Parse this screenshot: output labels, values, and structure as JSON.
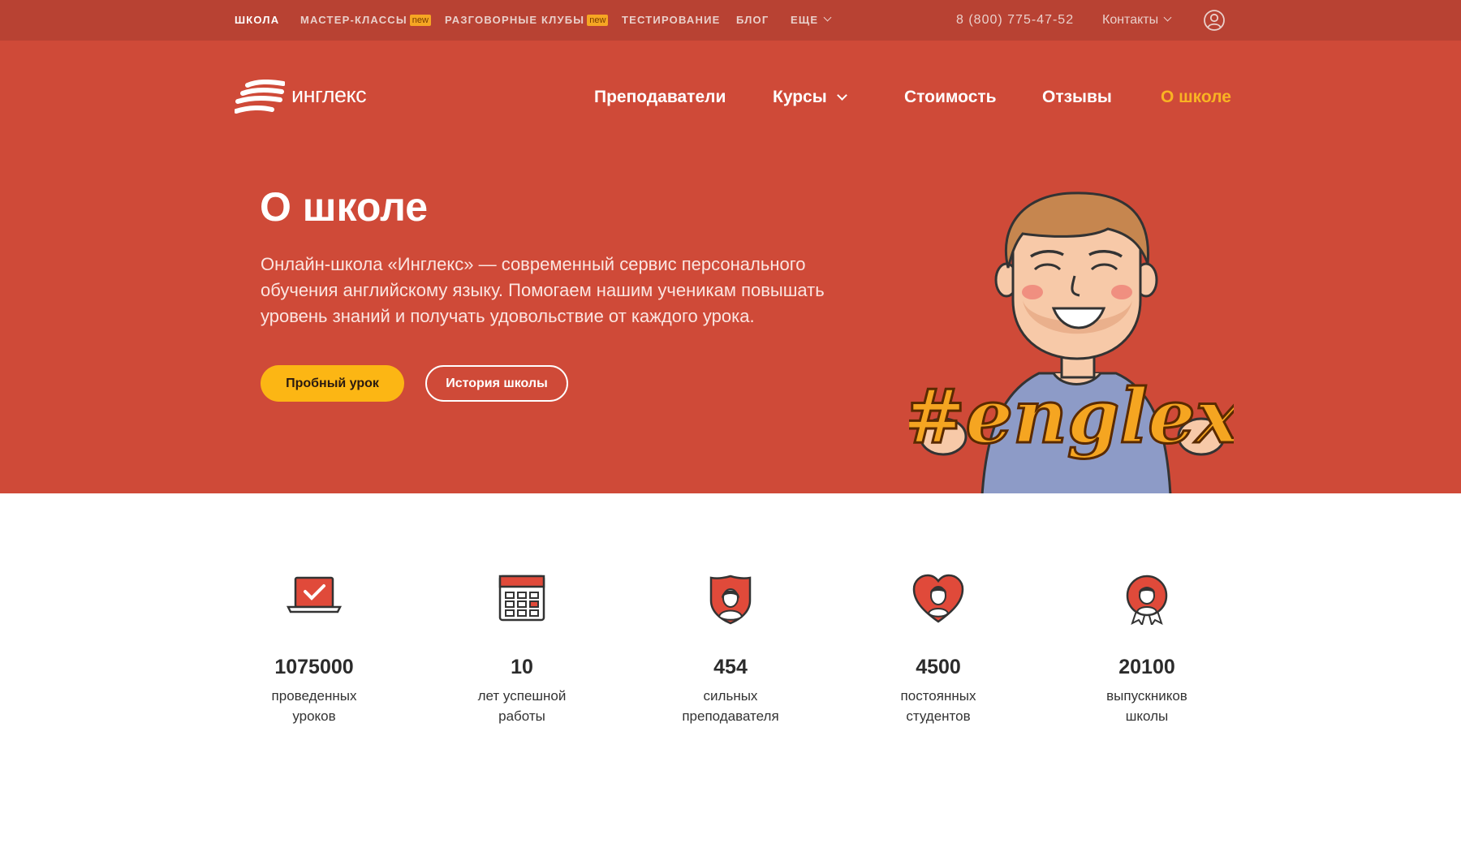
{
  "topbar": {
    "items": [
      {
        "label": "ШКОЛА"
      },
      {
        "label": "МАСТЕР-КЛАССЫ",
        "badge": "new"
      },
      {
        "label": "РАЗГОВОРНЫЕ КЛУБЫ",
        "badge": "new"
      },
      {
        "label": "ТЕСТИРОВАНИЕ"
      },
      {
        "label": "БЛОГ"
      },
      {
        "label": "ЕЩЕ"
      }
    ],
    "phone": "8 (800) 775-47-52",
    "contacts": "Контакты",
    "icons": {
      "user": "user-icon",
      "chevron": "chevron-down-icon"
    }
  },
  "brand": {
    "name": "инглекс",
    "logo_icon": "englex-wave-logo-icon"
  },
  "mainnav": [
    {
      "label": "Преподаватели"
    },
    {
      "label": "Курсы"
    },
    {
      "label": "Стоимость"
    },
    {
      "label": "Отзывы"
    },
    {
      "label": "О школе"
    }
  ],
  "hero": {
    "title": "О школе",
    "lead": "Онлайн-школа «Инглекс» — современный сервис персонального обучения английскому языку. Помогаем нашим ученикам повышать уровень знаний и получать удовольствие от каждого урока.",
    "btn_trial": "Пробный урок",
    "btn_history": "История школы",
    "mascot_sign": "#englex"
  },
  "stats": [
    {
      "icon": "laptop-check-icon",
      "number": "1075000",
      "label_line1": "проведенных",
      "label_line2": "уроков"
    },
    {
      "icon": "calendar-icon",
      "number": "10",
      "label_line1": "лет успешной",
      "label_line2": "работы"
    },
    {
      "icon": "teacher-shield-icon",
      "number": "454",
      "label_line1": "сильных",
      "label_line2": "преподавателя"
    },
    {
      "icon": "student-heart-icon",
      "number": "4500",
      "label_line1": "постоянных",
      "label_line2": "студентов"
    },
    {
      "icon": "graduate-award-icon",
      "number": "20100",
      "label_line1": "выпускников",
      "label_line2": "школы"
    }
  ],
  "colors": {
    "topbar": "#b84233",
    "hero": "#cf4a38",
    "accent": "#fcb614",
    "active_nav": "#f9b323"
  }
}
